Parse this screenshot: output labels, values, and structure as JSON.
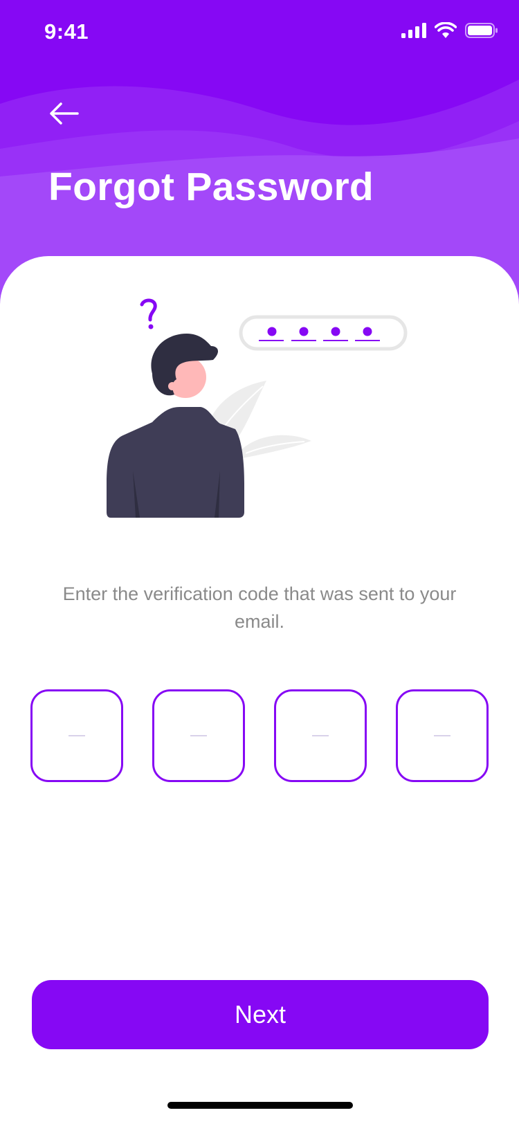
{
  "status_bar": {
    "time": "9:41"
  },
  "header": {
    "title": "Forgot Password",
    "back_icon": "arrow-left-icon",
    "color": "#8608F4"
  },
  "instruction": "Enter the verification code that was sent to your email.",
  "otp": {
    "digits": [
      "",
      "",
      "",
      ""
    ],
    "border_color": "#8608F4"
  },
  "next_button": {
    "label": "Next"
  }
}
